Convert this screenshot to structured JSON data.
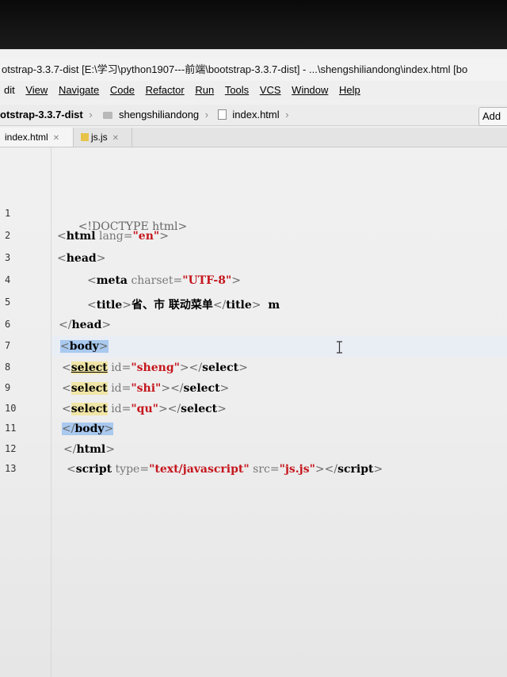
{
  "window": {
    "title": "otstrap-3.3.7-dist [E:\\学习\\python1907---前端\\bootstrap-3.3.7-dist] - ...\\shengshiliandong\\index.html [bo"
  },
  "menu": {
    "items": [
      "dit",
      "View",
      "Navigate",
      "Code",
      "Refactor",
      "Run",
      "Tools",
      "VCS",
      "Window",
      "Help"
    ]
  },
  "nav": {
    "project": "otstrap-3.3.7-dist",
    "folder": "shengshiliandong",
    "file": "index.html",
    "add_button": "Add"
  },
  "tabs": [
    {
      "label": "index.html"
    },
    {
      "label": "js.js"
    }
  ],
  "editor": {
    "line_numbers": [
      "1",
      "2",
      "3",
      "4",
      "5",
      "6",
      "7",
      "8",
      "9",
      "10",
      "11",
      "12",
      "13"
    ],
    "lines": {
      "l1": {
        "doctype": "<!DOCTYPE html>"
      },
      "l2": {
        "tag": "html",
        "attr": "lang=",
        "val": "\"en\""
      },
      "l3": {
        "tag": "head"
      },
      "l4": {
        "tag": "meta",
        "attr": "charset=",
        "val": "\"UTF-8\""
      },
      "l5": {
        "tag": "title",
        "text": "省、市 联动菜单",
        "close": "title",
        "tail": "m"
      },
      "l6": {
        "tag": "head"
      },
      "l7": {
        "tag": "body"
      },
      "l8": {
        "tag": "select",
        "attr": "id=",
        "val": "\"sheng\"",
        "close": "select"
      },
      "l9": {
        "tag": "select",
        "attr": "id=",
        "val": "\"shi\"",
        "close": "select"
      },
      "l10": {
        "tag": "select",
        "attr": "id=",
        "val": "\"qu\"",
        "close": "select"
      },
      "l11": {
        "tag": "body"
      },
      "l12": {
        "tag": "html"
      },
      "l13": {
        "tag": "script",
        "attr1": "type=",
        "val1": "\"text/javascript\"",
        "attr2": "src=",
        "val2": "\"js.js\"",
        "close": "script"
      }
    }
  }
}
